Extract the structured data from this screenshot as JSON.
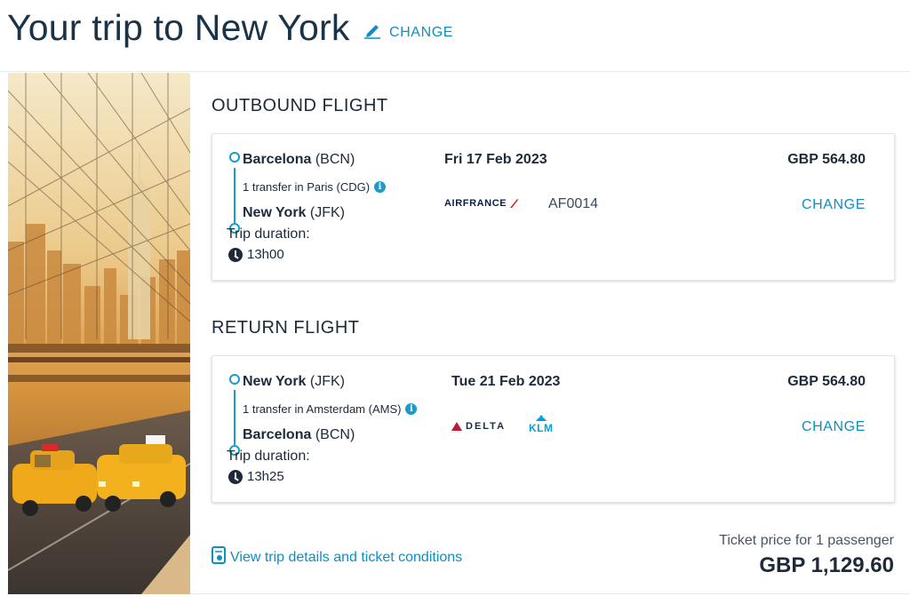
{
  "header": {
    "title": "Your trip to New York",
    "change_label": "CHANGE"
  },
  "outbound": {
    "section_title": "OUTBOUND FLIGHT",
    "origin_city": "Barcelona",
    "origin_code": "(BCN)",
    "transfer": "1 transfer in Paris (CDG)",
    "destination_city": "New York",
    "destination_code": "(JFK)",
    "duration_label": "Trip duration:",
    "duration": "13h00",
    "date": "Fri 17 Feb 2023",
    "airline_logo": "AIRFRANCE",
    "flight_number": "AF0014",
    "price": "GBP 564.80",
    "change_label": "CHANGE"
  },
  "return": {
    "section_title": "RETURN FLIGHT",
    "origin_city": "New York",
    "origin_code": "(JFK)",
    "transfer": "1 transfer in Amsterdam (AMS)",
    "destination_city": "Barcelona",
    "destination_code": "(BCN)",
    "duration_label": "Trip duration:",
    "duration": "13h25",
    "date": "Tue 21 Feb 2023",
    "airline_logos": [
      "DELTA",
      "KLM"
    ],
    "price": "GBP 564.80",
    "change_label": "CHANGE"
  },
  "footer": {
    "details_link": "View trip details and ticket conditions",
    "ticket_label": "Ticket price for 1 passenger",
    "ticket_total": "GBP 1,129.60"
  },
  "icons": {
    "edit": "pencil-icon",
    "info": "info-icon",
    "clock": "clock-icon",
    "document": "ticket-document-icon"
  },
  "colors": {
    "accent": "#0e8fc0",
    "route_line": "#1a9bc8",
    "text": "#1d2a3a",
    "airfrance_red": "#d62027",
    "delta_red": "#c01933",
    "klm_blue": "#00a1de"
  }
}
